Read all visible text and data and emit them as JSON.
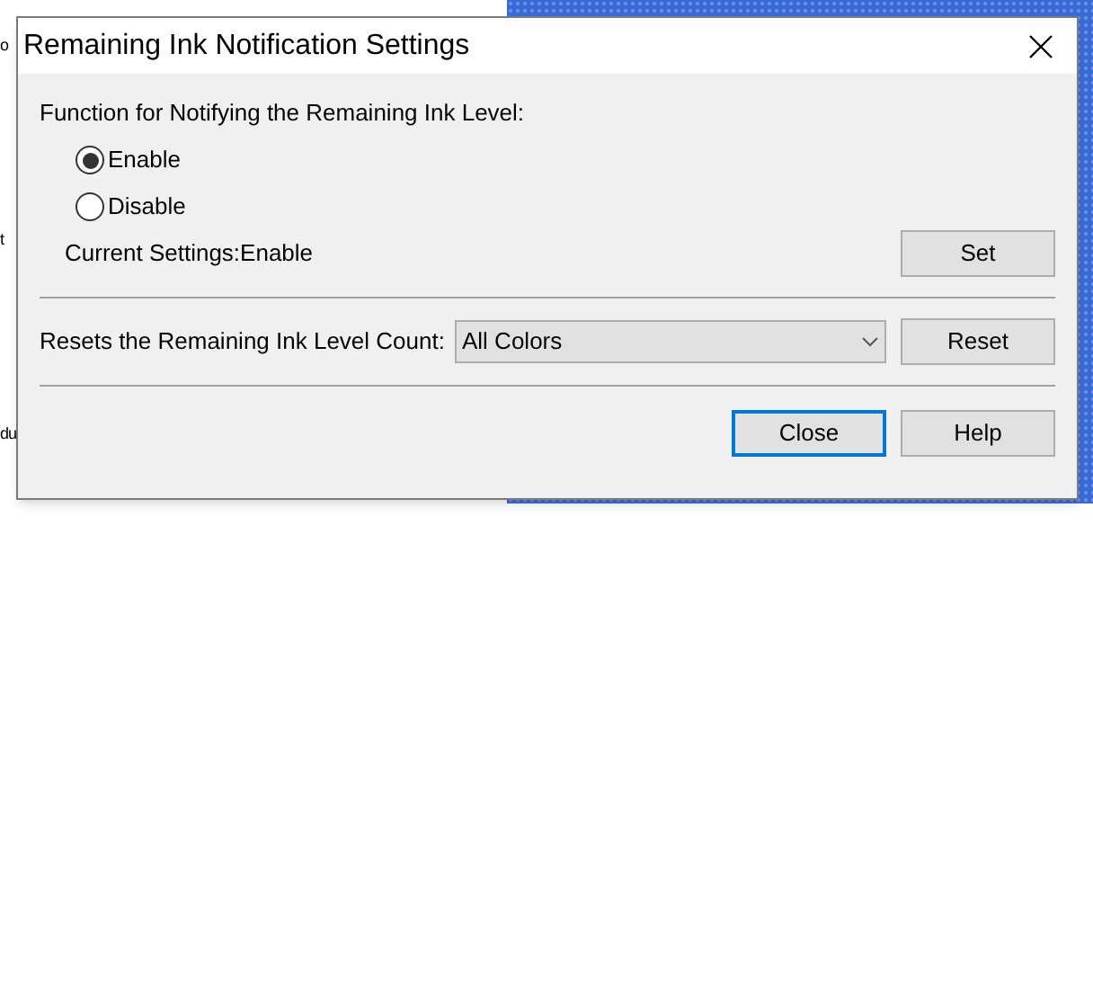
{
  "background_fragments": [
    "o",
    "t",
    "du"
  ],
  "dialog": {
    "title": "Remaining Ink Notification Settings",
    "function_label": "Function for Notifying the Remaining Ink Level:",
    "options": [
      {
        "label": "Enable",
        "selected": true
      },
      {
        "label": "Disable",
        "selected": false
      }
    ],
    "current_settings": "Current Settings:Enable",
    "set_button": "Set",
    "reset_label": "Resets the Remaining Ink Level Count:",
    "reset_select": {
      "value": "All Colors"
    },
    "reset_button": "Reset",
    "buttons": [
      {
        "label": "Close",
        "default": true
      },
      {
        "label": "Help",
        "default": false
      }
    ]
  }
}
